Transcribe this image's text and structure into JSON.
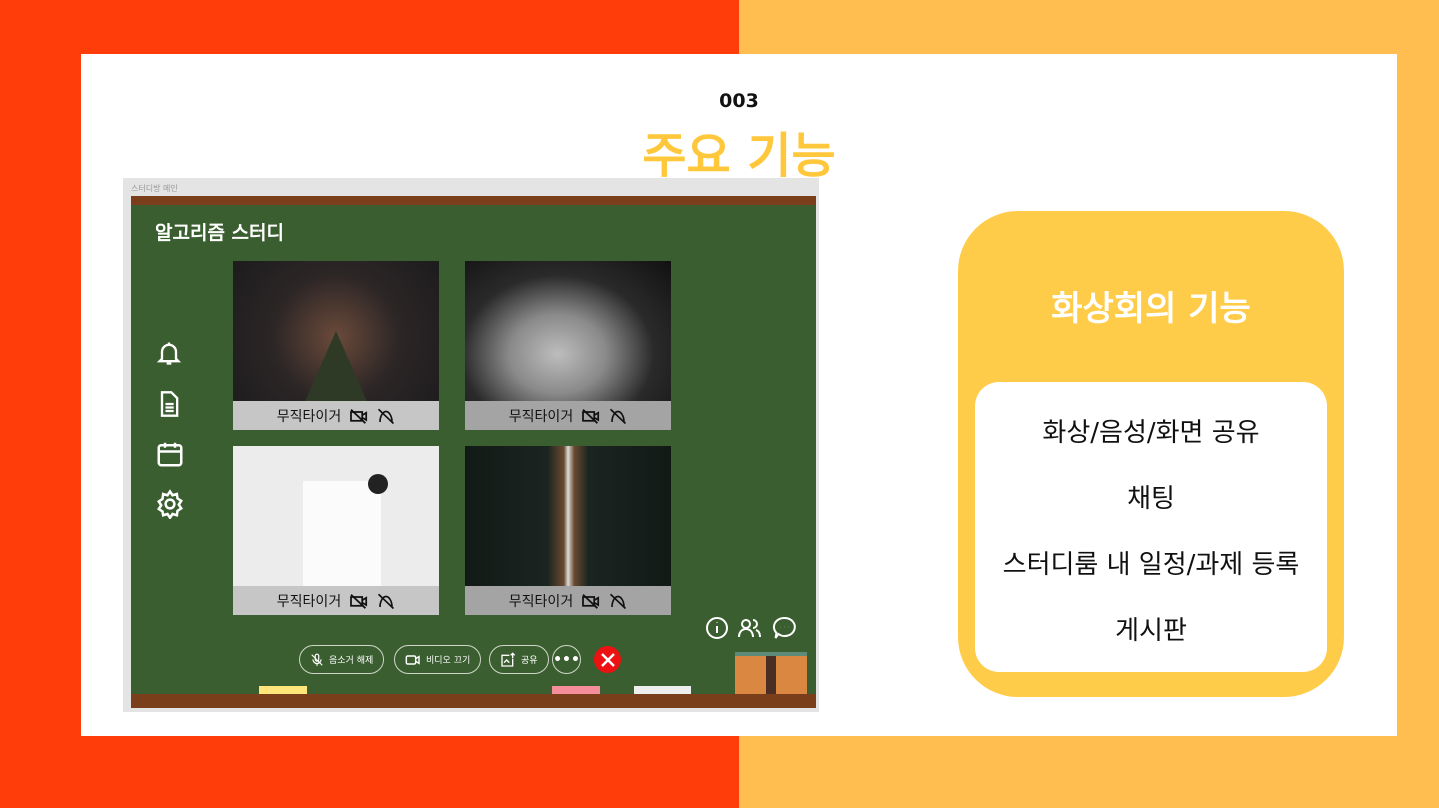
{
  "slide": {
    "number": "003",
    "title": "주요 기능"
  },
  "app": {
    "window_title": "스터디방 메인",
    "room_title": "알고리즘 스터디",
    "sidebar": [
      {
        "icon": "bell-icon"
      },
      {
        "icon": "document-icon"
      },
      {
        "icon": "calendar-icon"
      },
      {
        "icon": "gear-icon"
      }
    ],
    "participants": [
      {
        "name": "무직타이거"
      },
      {
        "name": "무직타이거"
      },
      {
        "name": "무직타이거"
      },
      {
        "name": "무직타이거"
      }
    ],
    "controls": {
      "unmute": "음소거 해제",
      "video_off": "비디오 끄기",
      "share": "공유"
    },
    "colors": {
      "board": "#3a5e2f",
      "frame": "#7a3e1a",
      "leave": "#ee1111"
    }
  },
  "features": {
    "title": "화상회의 기능",
    "items": [
      "화상/음성/화면 공유",
      "채팅",
      "스터디룸 내 일정/과제 등록",
      "게시판"
    ]
  },
  "colors": {
    "left_bg": "#FF3D0A",
    "right_bg": "#FFBE4F",
    "accent": "#FFC83C",
    "panel": "#FFCC4A"
  }
}
